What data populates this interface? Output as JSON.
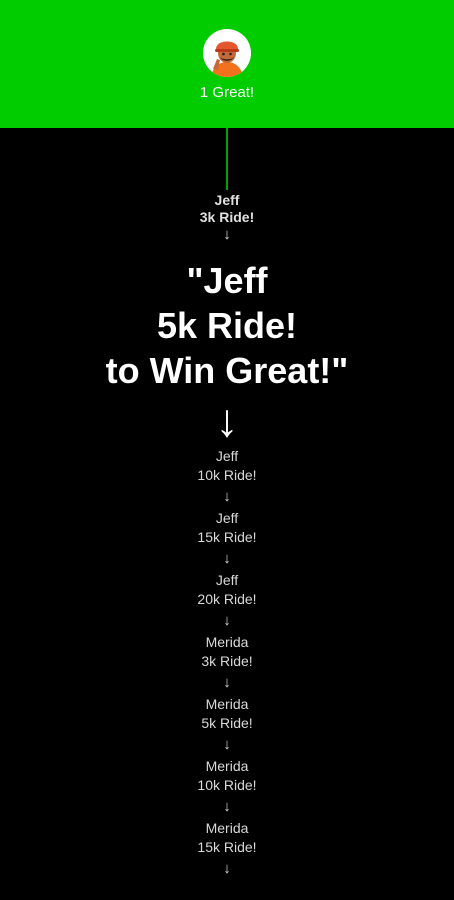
{
  "header": {
    "label": "1 Great!",
    "background": "#00cc00",
    "avatar_icon": "person-avatar-icon"
  },
  "current": {
    "line1": "Jeff",
    "line2": "3k Ride!",
    "arrow": "↓"
  },
  "goal": {
    "line1": "\"Jeff",
    "line2": "5k Ride!",
    "line3": "to Win Great!\"",
    "arrow": "↓"
  },
  "upcoming": [
    {
      "name": "Jeff",
      "ride": "10k Ride!",
      "arrow": "↓"
    },
    {
      "name": "Jeff",
      "ride": "15k Ride!",
      "arrow": "↓"
    },
    {
      "name": "Jeff",
      "ride": "20k Ride!",
      "arrow": "↓"
    },
    {
      "name": "Merida",
      "ride": "3k Ride!",
      "arrow": "↓"
    },
    {
      "name": "Merida",
      "ride": "5k Ride!",
      "arrow": "↓"
    },
    {
      "name": "Merida",
      "ride": "10k Ride!",
      "arrow": "↓"
    },
    {
      "name": "Merida",
      "ride": "15k Ride!",
      "arrow": "↓"
    }
  ]
}
